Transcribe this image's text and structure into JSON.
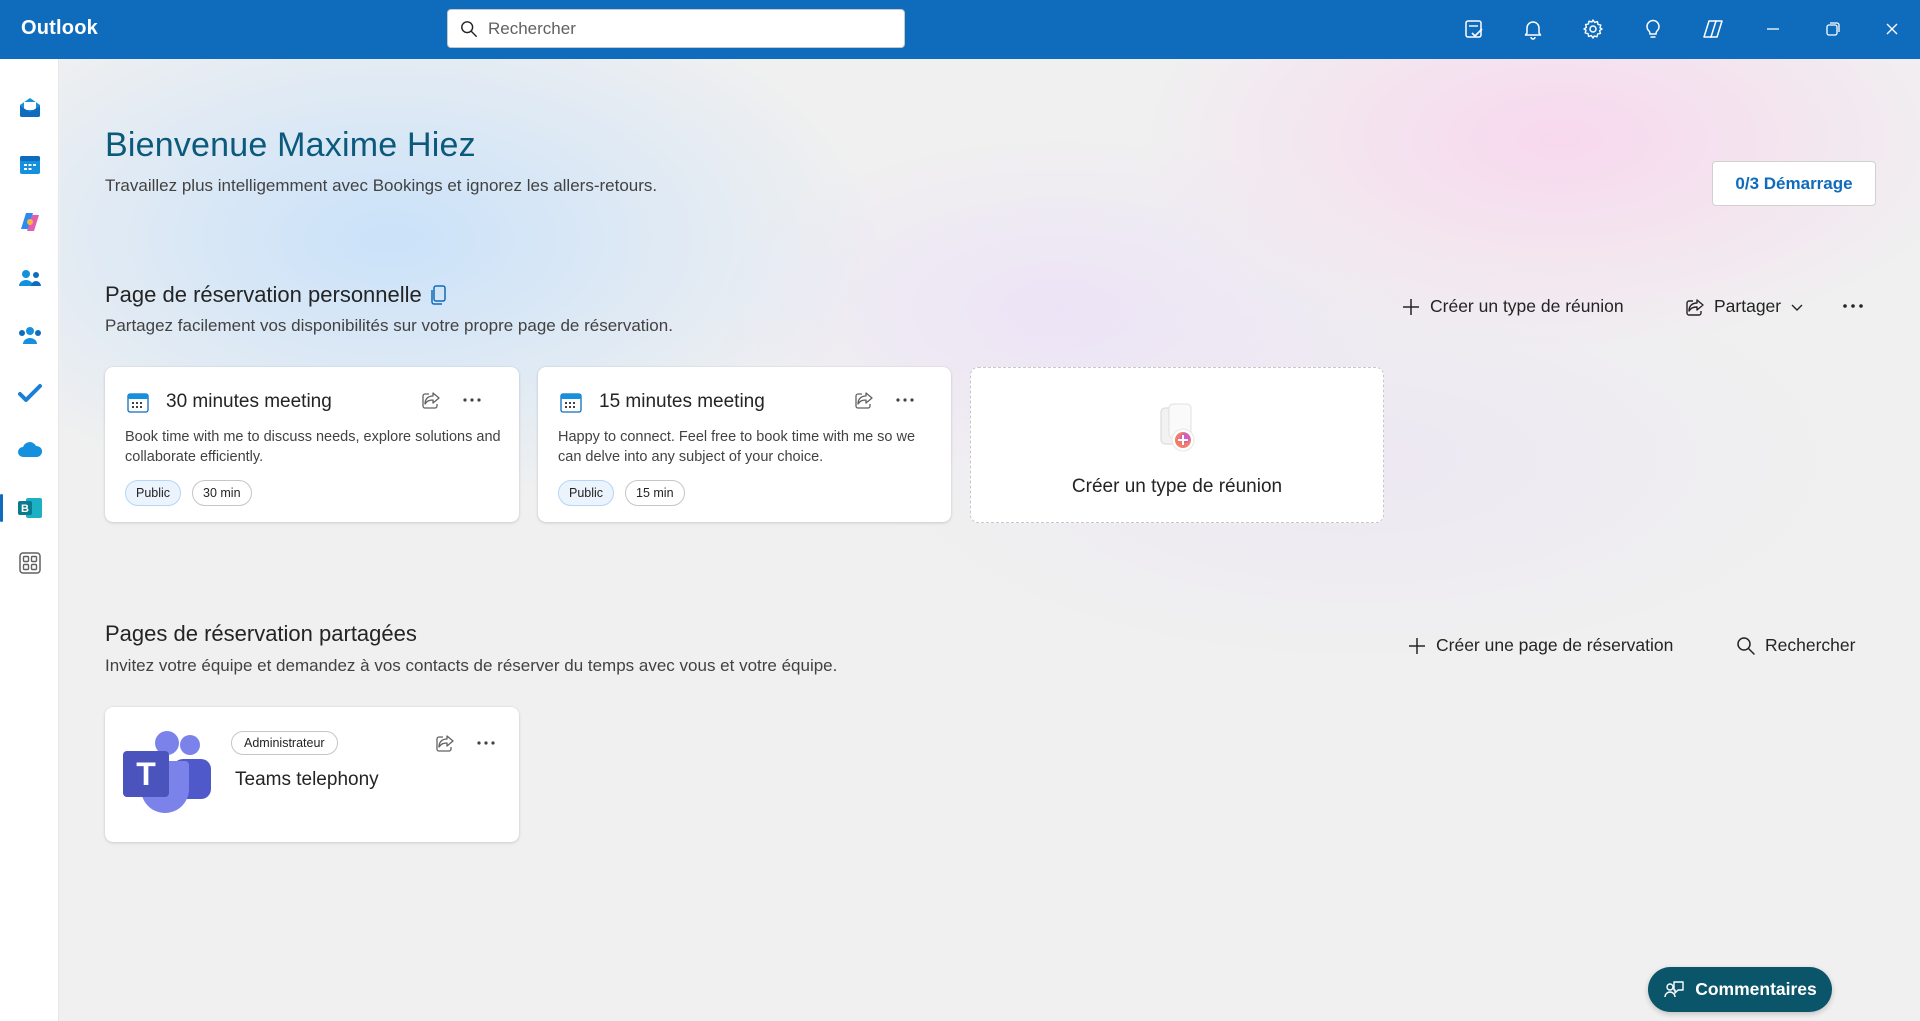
{
  "app": {
    "title": "Outlook"
  },
  "search": {
    "placeholder": "Rechercher"
  },
  "titlebar_icons": [
    "notes-check-icon",
    "bell-icon",
    "gear-icon",
    "lightbulb-icon",
    "copilot-icon",
    "minimize-icon",
    "restore-icon",
    "close-icon"
  ],
  "rail": {
    "items": [
      {
        "name": "mail",
        "icon": "mail-icon"
      },
      {
        "name": "calendar",
        "icon": "calendar-icon"
      },
      {
        "name": "copilot",
        "icon": "copilot-icon"
      },
      {
        "name": "people",
        "icon": "people-icon"
      },
      {
        "name": "groups",
        "icon": "groups-icon"
      },
      {
        "name": "todo",
        "icon": "todo-check-icon"
      },
      {
        "name": "onedrive",
        "icon": "cloud-icon"
      },
      {
        "name": "bookings",
        "icon": "bookings-icon",
        "active": true
      },
      {
        "name": "more-apps",
        "icon": "apps-grid-icon"
      }
    ]
  },
  "welcome": {
    "title": "Bienvenue Maxime Hiez",
    "subtitle": "Travaillez plus intelligemment avec Bookings et ignorez les allers-retours.",
    "start_button": "0/3 Démarrage"
  },
  "personal": {
    "title": "Page de réservation personnelle",
    "subtitle": "Partagez facilement vos disponibilités sur votre propre page de réservation.",
    "create_label": "Créer un type de réunion",
    "share_label": "Partager",
    "cards": [
      {
        "title": "30 minutes meeting",
        "description": "Book time with me to discuss needs, explore solutions and collaborate efficiently.",
        "visibility": "Public",
        "duration": "30 min"
      },
      {
        "title": "15 minutes meeting",
        "description": "Happy to connect. Feel free to book time with me so we can delve into any subject of your choice.",
        "visibility": "Public",
        "duration": "15 min"
      }
    ],
    "create_card_label": "Créer un type de réunion"
  },
  "shared": {
    "title": "Pages de réservation partagées",
    "subtitle": "Invitez votre équipe et demandez à vos contacts de réserver du temps avec vous et votre équipe.",
    "create_label": "Créer une page de réservation",
    "search_label": "Rechercher",
    "cards": [
      {
        "badge": "Administrateur",
        "title": "Teams telephony"
      }
    ]
  },
  "feedback": {
    "label": "Commentaires"
  },
  "colors": {
    "brand": "#0f6cbd",
    "heading": "#0b5a7c",
    "feedback": "#0b556a"
  }
}
